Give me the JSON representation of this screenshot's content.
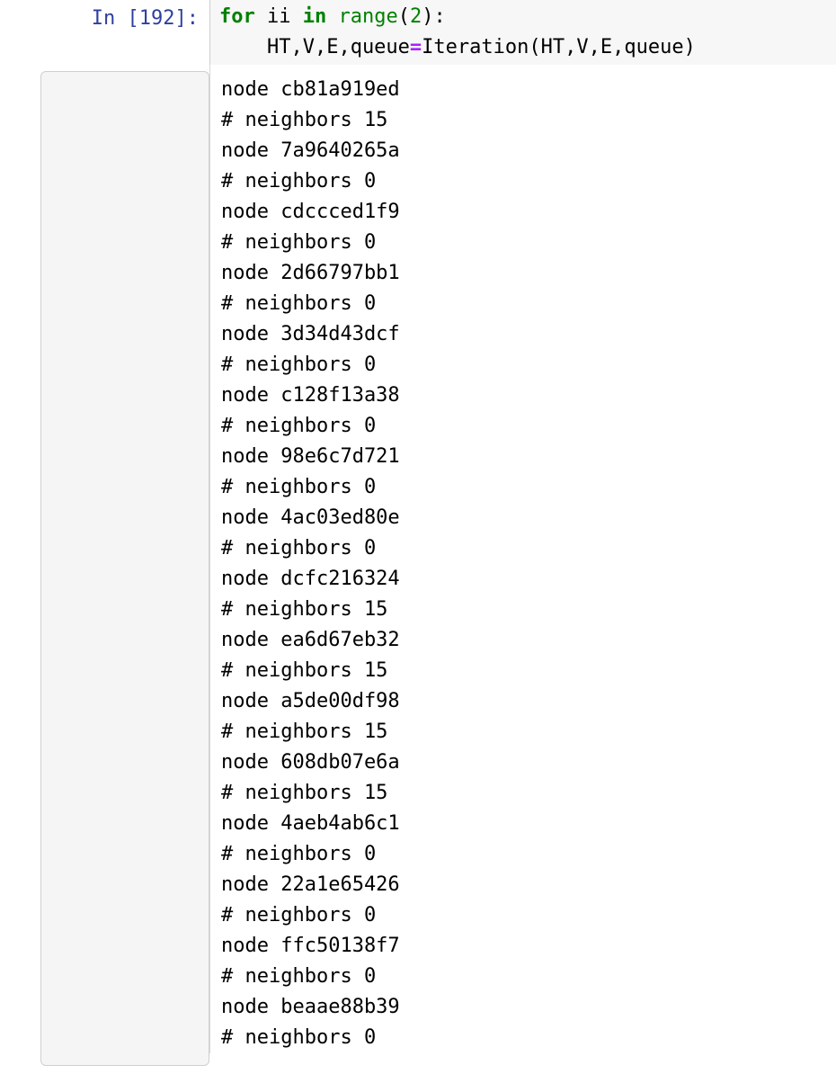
{
  "cell": {
    "input_prompt": "In [192]:",
    "code_lines": [
      [
        {
          "t": "for",
          "c": "kw"
        },
        {
          "t": " ii ",
          "c": "plain"
        },
        {
          "t": "in",
          "c": "kw"
        },
        {
          "t": " ",
          "c": "plain"
        },
        {
          "t": "range",
          "c": "builtin"
        },
        {
          "t": "(",
          "c": "plain"
        },
        {
          "t": "2",
          "c": "num"
        },
        {
          "t": "):",
          "c": "plain"
        }
      ],
      [
        {
          "t": "    HT,V,E,queue",
          "c": "plain"
        },
        {
          "t": "=",
          "c": "op"
        },
        {
          "t": "Iteration(HT,V,E,queue)",
          "c": "plain"
        }
      ]
    ],
    "output_prompt": "",
    "output_lines": [
      "node cb81a919ed",
      "# neighbors 15",
      "node 7a9640265a",
      "# neighbors 0",
      "node cdccced1f9",
      "# neighbors 0",
      "node 2d66797bb1",
      "# neighbors 0",
      "node 3d34d43dcf",
      "# neighbors 0",
      "node c128f13a38",
      "# neighbors 0",
      "node 98e6c7d721",
      "# neighbors 0",
      "node 4ac03ed80e",
      "# neighbors 0",
      "node dcfc216324",
      "# neighbors 15",
      "node ea6d67eb32",
      "# neighbors 15",
      "node a5de00df98",
      "# neighbors 15",
      "node 608db07e6a",
      "# neighbors 15",
      "node 4aeb4ab6c1",
      "# neighbors 0",
      "node 22a1e65426",
      "# neighbors 0",
      "node ffc50138f7",
      "# neighbors 0",
      "node beaae88b39",
      "# neighbors 0"
    ]
  },
  "colors": {
    "prompt": "#303f9f",
    "keyword": "#008000",
    "operator": "#aa22ff",
    "input_background": "#f7f7f7",
    "gutter_box_background": "#f5f5f5",
    "border": "#cfcfcf",
    "text": "#000000"
  }
}
